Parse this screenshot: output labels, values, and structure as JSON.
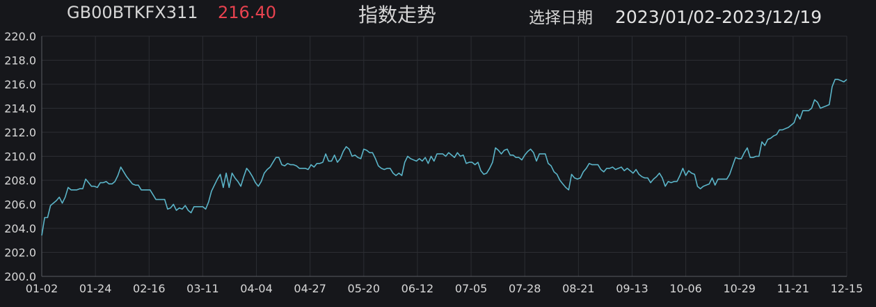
{
  "header": {
    "symbol": "GB00BTKFX311",
    "price": "216.40",
    "title": "指数走势",
    "date_label": "选择日期",
    "date_range": "2023/01/02-2023/12/19"
  },
  "colors": {
    "background": "#16171b",
    "line": "#5bb5c9",
    "grid": "#2c2e33",
    "axis": "#5a5d63",
    "price_up": "#e8424f",
    "text": "#d8d8d8"
  },
  "chart_data": {
    "type": "line",
    "title": "",
    "xlabel": "",
    "ylabel": "",
    "ylim": [
      200,
      220
    ],
    "grid": true,
    "y_ticks": [
      "200.0",
      "202.0",
      "204.0",
      "206.0",
      "208.0",
      "210.0",
      "212.0",
      "214.0",
      "216.0",
      "218.0",
      "220.0"
    ],
    "x_ticks": [
      "01-02",
      "01-24",
      "02-16",
      "03-11",
      "04-04",
      "04-27",
      "05-20",
      "06-12",
      "07-05",
      "07-28",
      "08-21",
      "09-13",
      "10-06",
      "10-29",
      "11-21",
      "12-15"
    ],
    "series": [
      {
        "name": "",
        "values": [
          203.4,
          204.9,
          204.9,
          205.9,
          206.1,
          206.3,
          206.6,
          206.1,
          206.6,
          207.4,
          207.2,
          207.2,
          207.2,
          207.3,
          207.3,
          208.1,
          207.8,
          207.5,
          207.5,
          207.4,
          207.8,
          207.8,
          207.9,
          207.7,
          207.7,
          207.9,
          208.4,
          209.1,
          208.7,
          208.3,
          208.0,
          207.7,
          207.6,
          207.6,
          207.2,
          207.2,
          207.2,
          207.2,
          206.8,
          206.4,
          206.4,
          206.4,
          206.4,
          205.6,
          205.7,
          206.0,
          205.5,
          205.7,
          205.6,
          205.9,
          205.5,
          205.3,
          205.8,
          205.8,
          205.8,
          205.8,
          205.6,
          206.2,
          207.1,
          207.6,
          208.1,
          208.5,
          207.4,
          208.6,
          207.4,
          208.6,
          208.2,
          207.9,
          207.5,
          208.3,
          209.0,
          208.7,
          208.3,
          207.8,
          207.5,
          207.9,
          208.6,
          208.9,
          209.1,
          209.5,
          209.9,
          209.9,
          209.3,
          209.2,
          209.4,
          209.3,
          209.3,
          209.2,
          209.0,
          209.0,
          209.0,
          208.9,
          209.3,
          209.1,
          209.4,
          209.4,
          209.5,
          210.2,
          209.6,
          209.6,
          210.1,
          209.5,
          209.8,
          210.4,
          210.8,
          210.6,
          210.0,
          210.1,
          209.9,
          209.8,
          210.6,
          210.5,
          210.3,
          210.3,
          209.8,
          209.2,
          209.0,
          208.9,
          209.0,
          209.0,
          208.6,
          208.4,
          208.6,
          208.4,
          209.5,
          210.0,
          209.8,
          209.7,
          209.6,
          209.8,
          209.6,
          209.9,
          209.4,
          210.0,
          209.6,
          210.2,
          210.2,
          210.2,
          210.0,
          210.3,
          210.1,
          209.9,
          210.3,
          210.0,
          210.1,
          209.4,
          209.5,
          209.5,
          209.3,
          209.5,
          208.8,
          208.5,
          208.6,
          209.0,
          209.5,
          210.7,
          210.5,
          210.2,
          210.5,
          210.6,
          210.1,
          210.1,
          209.9,
          209.9,
          209.7,
          210.1,
          210.4,
          210.6,
          210.3,
          209.6,
          210.2,
          210.2,
          210.2,
          209.4,
          209.2,
          208.7,
          208.5,
          208.0,
          207.7,
          207.4,
          207.2,
          208.5,
          208.2,
          208.1,
          208.2,
          208.7,
          209.0,
          209.4,
          209.3,
          209.3,
          209.3,
          208.9,
          208.7,
          209.0,
          209.0,
          209.1,
          208.9,
          209.0,
          209.1,
          208.8,
          209.0,
          208.8,
          208.6,
          208.9,
          208.5,
          208.3,
          208.2,
          208.2,
          207.8,
          208.1,
          208.3,
          208.6,
          208.2,
          207.5,
          207.9,
          207.8,
          207.9,
          207.9,
          208.4,
          209.0,
          208.4,
          208.8,
          208.6,
          208.5,
          207.5,
          207.3,
          207.5,
          207.6,
          207.7,
          208.2,
          207.6,
          208.1,
          208.1,
          208.1,
          208.1,
          208.5,
          209.2,
          209.9,
          209.8,
          209.8,
          210.3,
          210.7,
          209.9,
          209.9,
          210.0,
          210.0,
          211.2,
          210.9,
          211.4,
          211.5,
          211.7,
          211.8,
          212.2,
          212.2,
          212.3,
          212.4,
          212.6,
          212.8,
          213.5,
          213.1,
          213.8,
          213.8,
          213.8,
          214.0,
          214.7,
          214.5,
          214.0,
          214.1,
          214.2,
          214.3,
          215.8,
          216.4,
          216.4,
          216.3,
          216.2,
          216.4
        ]
      }
    ]
  }
}
